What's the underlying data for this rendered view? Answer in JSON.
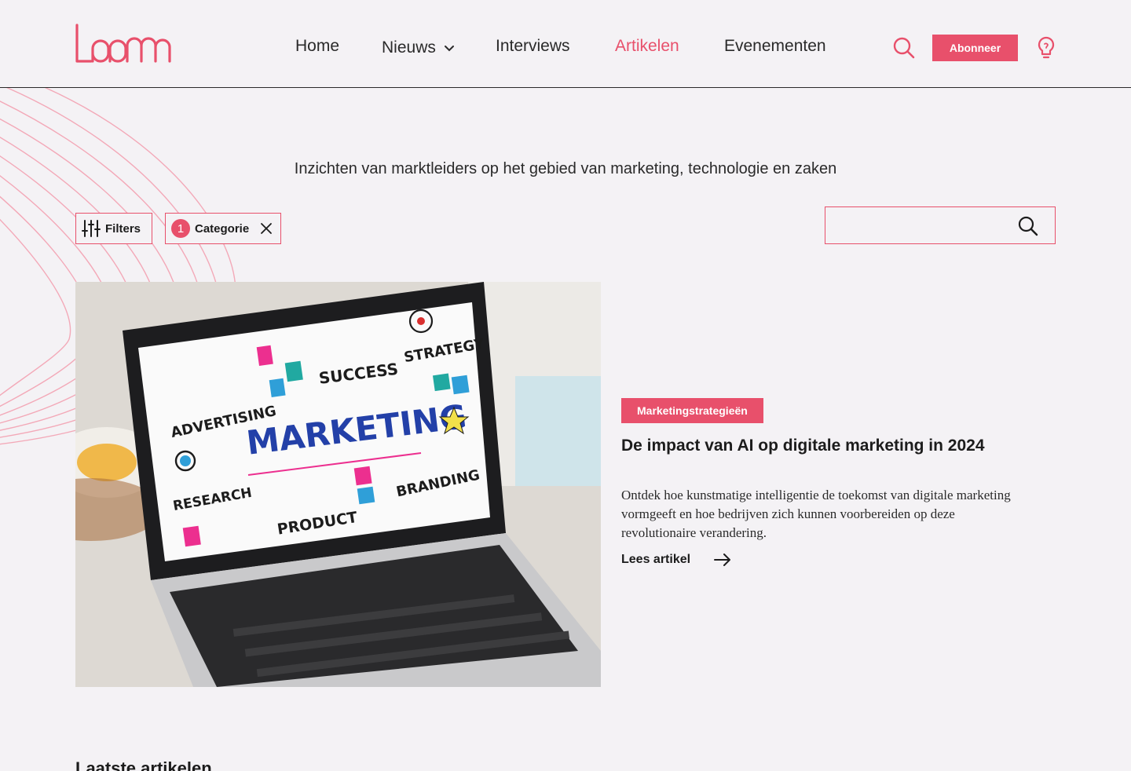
{
  "brand": {
    "name": "loom",
    "accent": "#e8506b"
  },
  "nav": {
    "items": [
      {
        "label": "Home"
      },
      {
        "label": "Nieuws"
      },
      {
        "label": "Interviews"
      },
      {
        "label": "Artikelen"
      },
      {
        "label": "Evenementen"
      }
    ],
    "active": "Artikelen"
  },
  "header": {
    "subscribe_label": "Abonneer",
    "search_icon": "search-icon",
    "idea_icon": "lightbulb-icon"
  },
  "tagline": "Inzichten van marktleiders op het gebied van marketing, technologie en zaken",
  "filters": {
    "filters_label": "Filters",
    "category_count": "1",
    "category_label": "Categorie"
  },
  "search": {
    "value": "",
    "placeholder": ""
  },
  "featured": {
    "category": "Marketingstrategieën",
    "title": "De impact van AI op digitale marketing in 2024",
    "description": "Ontdek hoe kunstmatige intelligentie de toekomst van digitale marketing vormgeeft en hoe bedrijven zich kunnen voorbereiden op deze revolutionaire verandering.",
    "read_more": "Lees artikel",
    "image": {
      "words": [
        "ADVERTISING",
        "SUCCESS",
        "STRATEGY",
        "MARKETING",
        "RESEARCH",
        "PRODUCT",
        "BRANDING"
      ]
    }
  },
  "latest": {
    "title": "Laatste artikelen"
  }
}
